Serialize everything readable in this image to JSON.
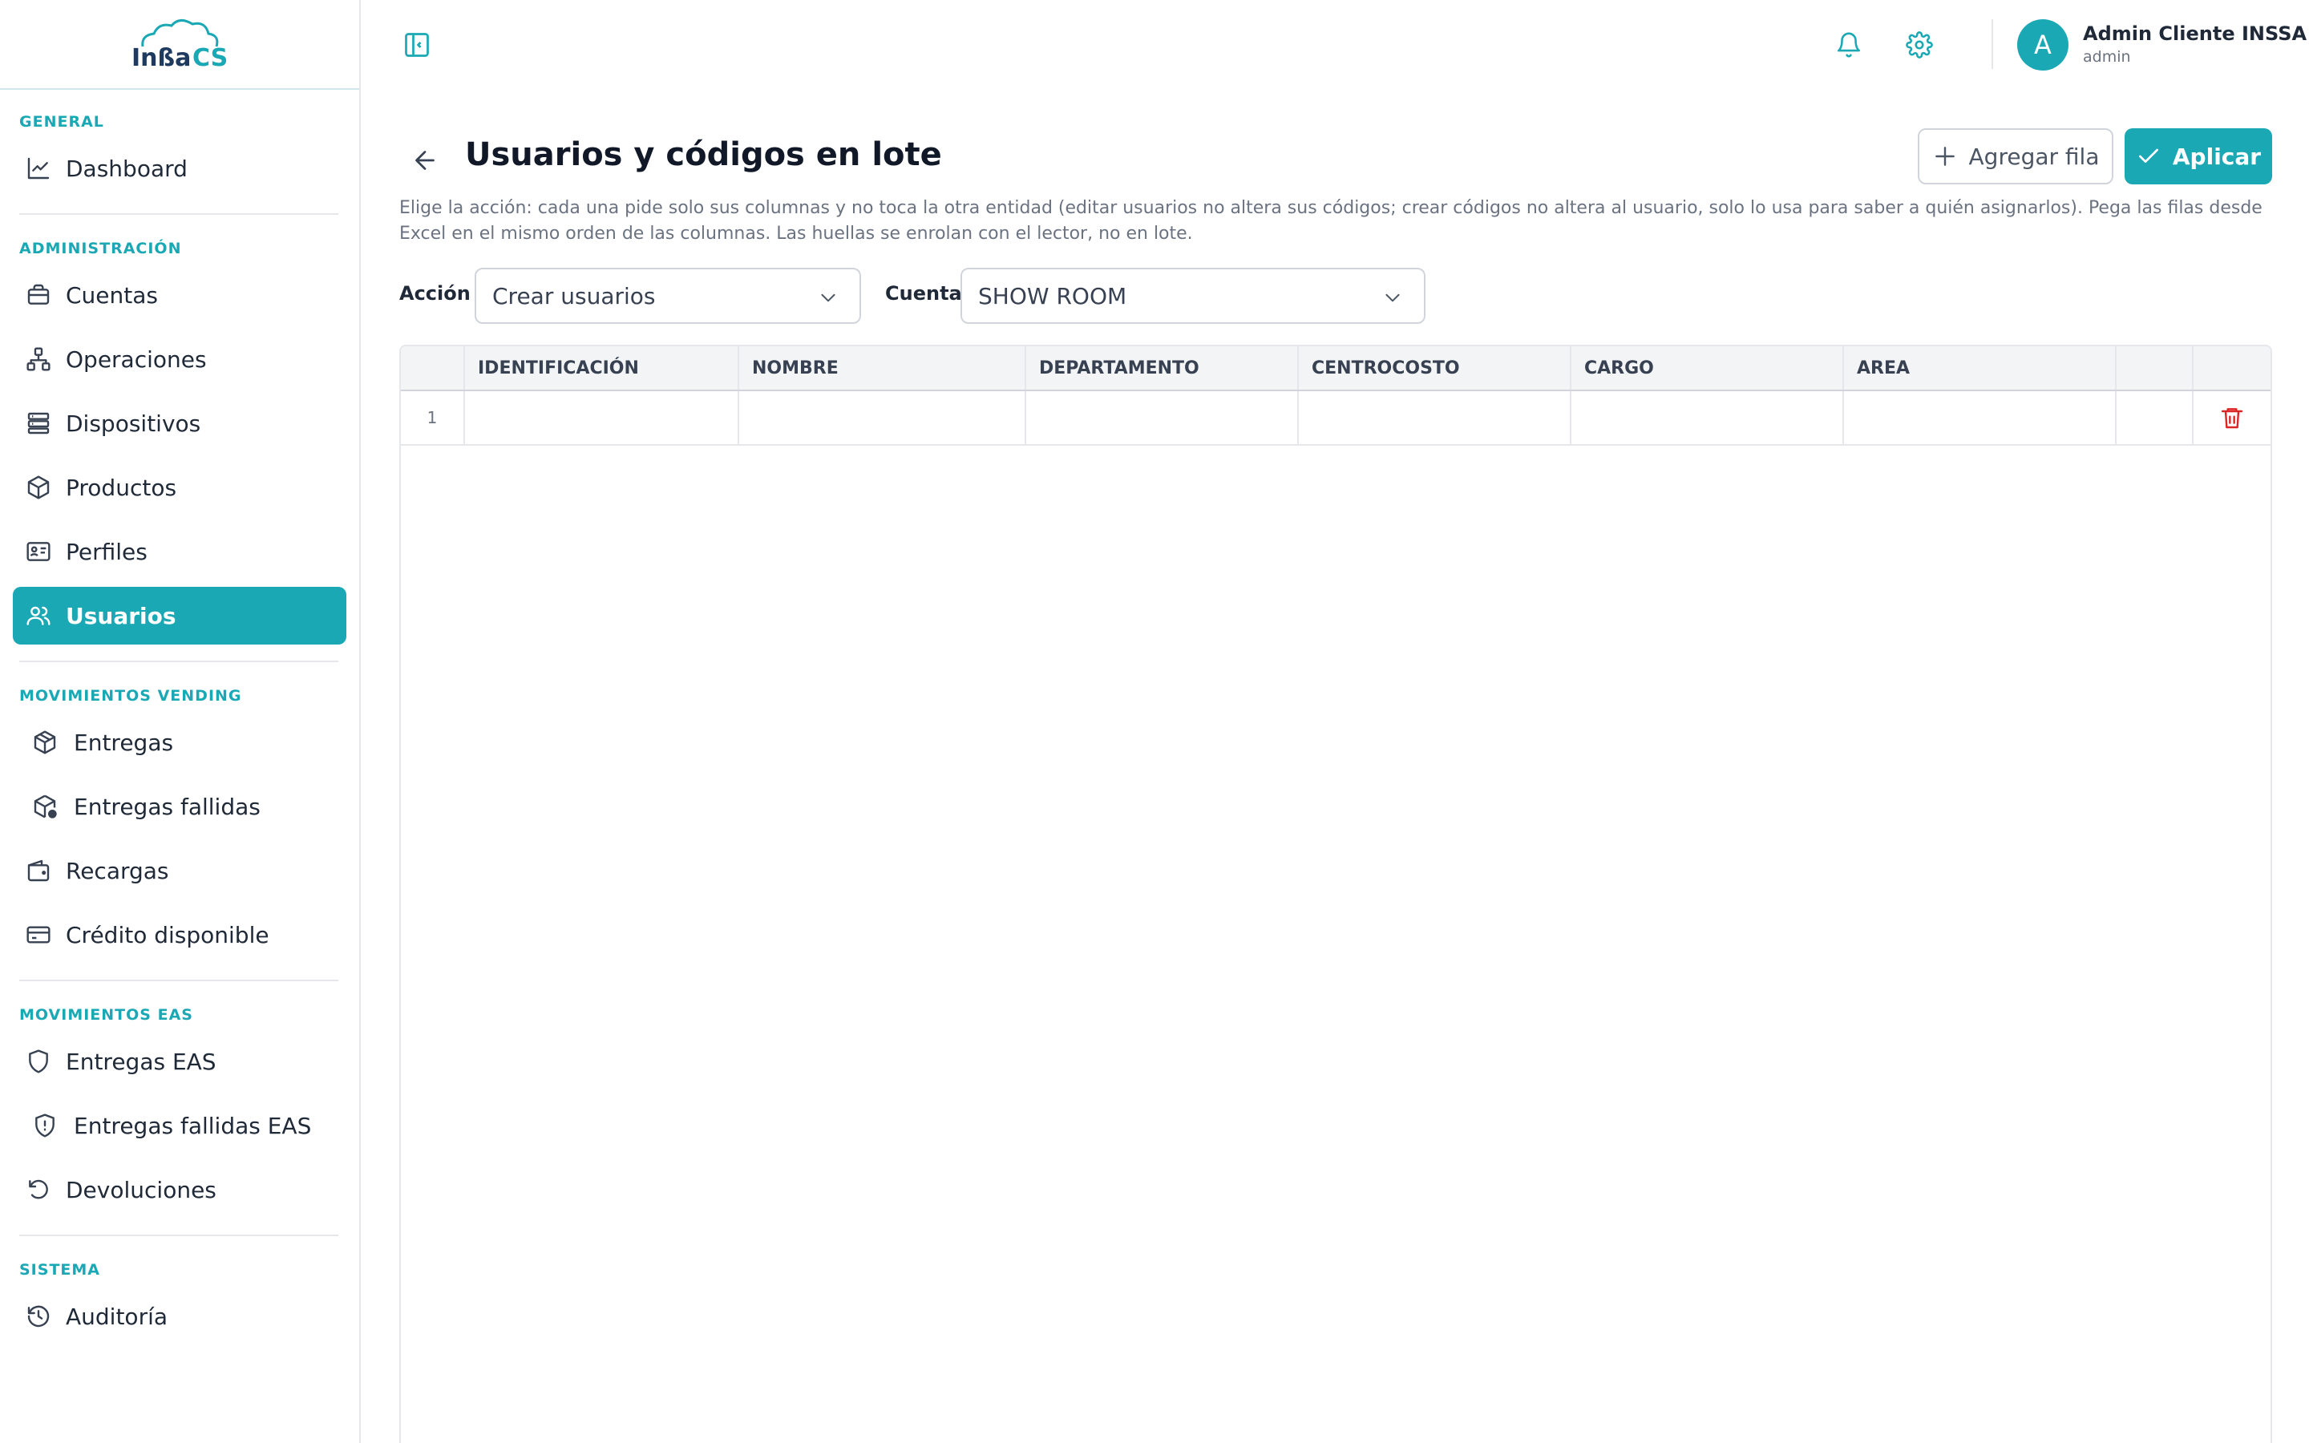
{
  "app": {
    "logo_text": "InSSa CS"
  },
  "sidebar": {
    "sections": [
      {
        "title": "GENERAL",
        "items": [
          {
            "label": "Dashboard",
            "icon": "chart-line-icon"
          }
        ]
      },
      {
        "title": "ADMINISTRACIÓN",
        "items": [
          {
            "label": "Cuentas",
            "icon": "briefcase-icon"
          },
          {
            "label": "Operaciones",
            "icon": "network-icon"
          },
          {
            "label": "Dispositivos",
            "icon": "server-icon"
          },
          {
            "label": "Productos",
            "icon": "box-icon"
          },
          {
            "label": "Perfiles",
            "icon": "id-card-icon"
          },
          {
            "label": "Usuarios",
            "icon": "users-icon",
            "active": true
          }
        ]
      },
      {
        "title": "MOVIMIENTOS VENDING",
        "items": [
          {
            "label": "Entregas",
            "icon": "package-icon"
          },
          {
            "label": "Entregas fallidas",
            "icon": "package-alert-icon"
          },
          {
            "label": "Recargas",
            "icon": "wallet-icon"
          },
          {
            "label": "Crédito disponible",
            "icon": "credit-card-icon"
          }
        ]
      },
      {
        "title": "MOVIMIENTOS EAS",
        "items": [
          {
            "label": "Entregas EAS",
            "icon": "shield-icon"
          },
          {
            "label": "Entregas fallidas EAS",
            "icon": "shield-alert-icon"
          },
          {
            "label": "Devoluciones",
            "icon": "rotate-ccw-icon"
          }
        ]
      },
      {
        "title": "SISTEMA",
        "items": [
          {
            "label": "Auditoría",
            "icon": "history-icon"
          }
        ]
      }
    ]
  },
  "header": {
    "user_initial": "A",
    "user_name": "Admin Cliente INSSA",
    "user_role": "admin"
  },
  "page": {
    "title": "Usuarios y códigos en lote",
    "add_row_label": "Agregar fila",
    "apply_label": "Aplicar",
    "description": "Elige la acción: cada una pide solo sus columnas y no toca la otra entidad (editar usuarios no altera sus códigos; crear códigos no altera al usuario, solo lo usa para saber a quién asignarlos). Pega las filas desde Excel en el mismo orden de las columnas. Las huellas se enrolan con el lector, no en lote.",
    "action_label": "Acción",
    "action_value": "Crear usuarios",
    "account_label": "Cuenta",
    "account_value": "SHOW ROOM"
  },
  "grid": {
    "columns": [
      "IDENTIFICACIÓN",
      "NOMBRE",
      "DEPARTAMENTO",
      "CENTROCOSTO",
      "CARGO",
      "AREA"
    ],
    "rows": [
      {
        "number": "1",
        "cells": [
          "",
          "",
          "",
          "",
          "",
          ""
        ]
      }
    ]
  },
  "colors": {
    "accent": "#1aa8b5",
    "danger": "#dc2626"
  }
}
